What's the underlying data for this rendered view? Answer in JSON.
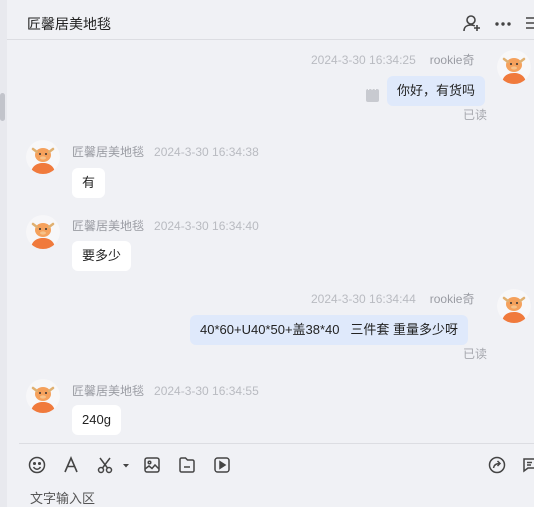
{
  "header": {
    "title": "匠馨居美地毯"
  },
  "messages": [
    {
      "side": "self",
      "name": "rookie奇",
      "time": "2024-3-30 16:34:25",
      "text": "你好，有货吗",
      "status": "已读"
    },
    {
      "side": "other",
      "name": "匠馨居美地毯",
      "time": "2024-3-30 16:34:38",
      "text": "有"
    },
    {
      "side": "other",
      "name": "匠馨居美地毯",
      "time": "2024-3-30 16:34:40",
      "text": "要多少"
    },
    {
      "side": "self",
      "name": "rookie奇",
      "time": "2024-3-30 16:34:44",
      "text": "40*60+U40*50+盖38*40   三件套 重量多少呀",
      "status": "已读"
    },
    {
      "side": "other",
      "name": "匠馨居美地毯",
      "time": "2024-3-30 16:34:55",
      "text": "240g"
    }
  ],
  "input": {
    "placeholder": "文字输入区"
  },
  "colors": {
    "background": "#f0f1f5",
    "self_bubble": "#dfe9fb",
    "other_bubble": "#ffffff",
    "avatar_orange": "#f07a3c"
  },
  "icons": {
    "header": [
      "add-user-icon",
      "more-icon",
      "menu-icon"
    ],
    "toolbar": [
      "emoji-icon",
      "font-icon",
      "scissors-icon",
      "image-icon",
      "file-icon",
      "video-icon",
      "share-icon",
      "chat-icon"
    ]
  }
}
